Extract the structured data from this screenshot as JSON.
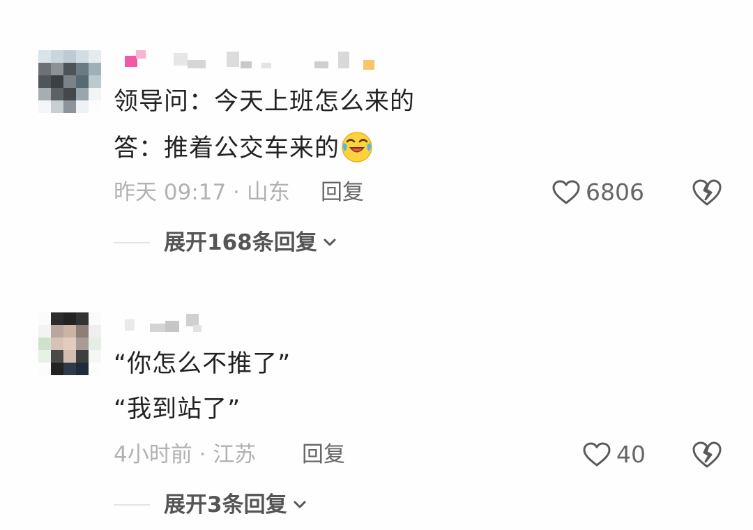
{
  "comments": [
    {
      "lines": [
        "领导问：今天上班怎么来的",
        "答：推着公交车来的"
      ],
      "emoji": "crying-laughing-face",
      "time_location": "昨天 09:17 · 山东",
      "reply_label": "回复",
      "likes": "6806",
      "expand_label": "展开168条回复"
    },
    {
      "lines": [
        "“你怎么不推了”",
        "“我到站了”"
      ],
      "time_location": "4小时前 · 江苏",
      "reply_label": "回复",
      "likes": "40",
      "expand_label": "展开3条回复"
    }
  ],
  "icons": {
    "like": "heart-outline-icon",
    "dislike": "broken-heart-icon",
    "expand": "chevron-down-icon"
  },
  "colors": {
    "primary_text": "#222222",
    "meta_text": "#b1b1b1",
    "action_text": "#666666"
  }
}
